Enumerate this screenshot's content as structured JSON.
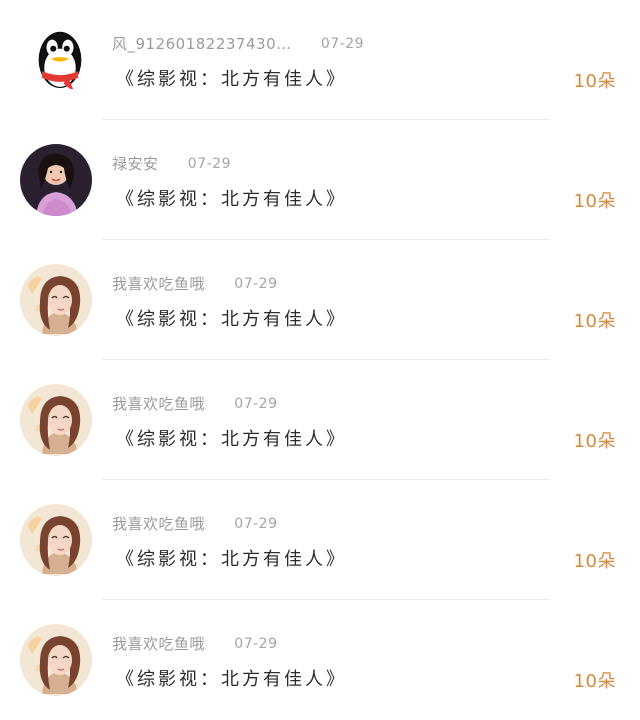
{
  "rows": [
    {
      "avatar": "penguin-avatar",
      "nickname": "风_91260182237430…",
      "date": "07-29",
      "title": "《综影视：北方有佳人》",
      "count": "10朵"
    },
    {
      "avatar": "girl-pink-avatar",
      "nickname": "禄安安",
      "date": "07-29",
      "title": "《综影视：北方有佳人》",
      "count": "10朵"
    },
    {
      "avatar": "illustrated-girl-avatar",
      "nickname": "我喜欢吃鱼哦",
      "date": "07-29",
      "title": "《综影视：北方有佳人》",
      "count": "10朵"
    },
    {
      "avatar": "illustrated-girl-avatar",
      "nickname": "我喜欢吃鱼哦",
      "date": "07-29",
      "title": "《综影视：北方有佳人》",
      "count": "10朵"
    },
    {
      "avatar": "illustrated-girl-avatar",
      "nickname": "我喜欢吃鱼哦",
      "date": "07-29",
      "title": "《综影视：北方有佳人》",
      "count": "10朵"
    },
    {
      "avatar": "illustrated-girl-avatar",
      "nickname": "我喜欢吃鱼哦",
      "date": "07-29",
      "title": "《综影视：北方有佳人》",
      "count": "10朵"
    }
  ],
  "colors": {
    "background": "#ffffff",
    "name": "#9b9b9b",
    "date": "#a5a5a5",
    "title": "#2b2b2b",
    "count": "#d48a3a",
    "divider": "#ececec"
  }
}
